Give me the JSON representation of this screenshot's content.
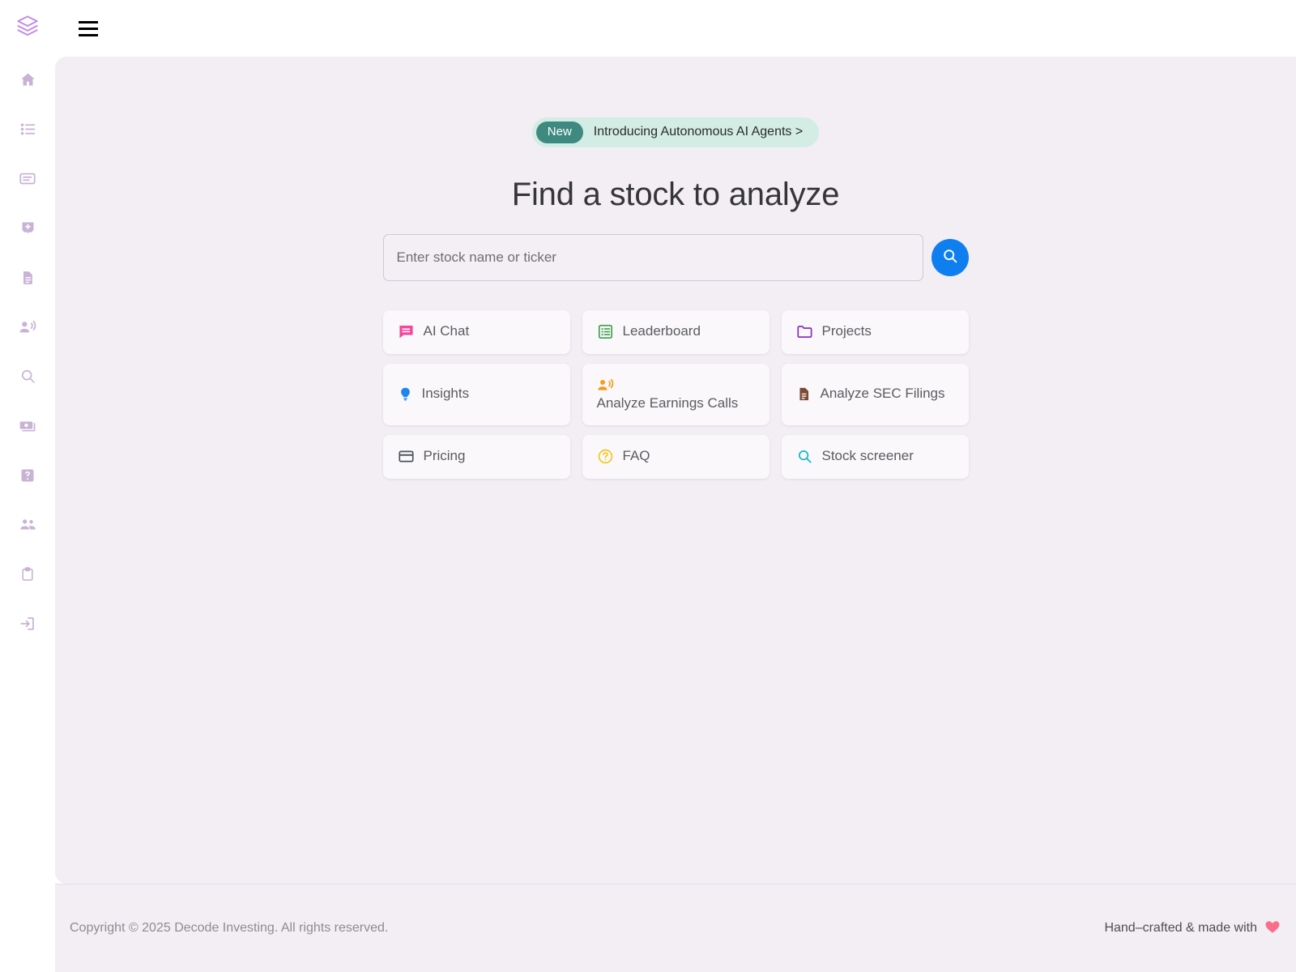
{
  "brand": {
    "logo_icon": "layers-icon",
    "logo_color": "#c48ae8"
  },
  "topbar": {
    "menu_icon": "hamburger-menu-icon"
  },
  "sidebar": {
    "items": [
      {
        "icon": "home-icon",
        "name": "home"
      },
      {
        "icon": "list-ordered-icon",
        "name": "watchlist"
      },
      {
        "icon": "monitor-list-icon",
        "name": "dashboard"
      },
      {
        "icon": "badge-plus-icon",
        "name": "add-stock"
      },
      {
        "icon": "document-icon",
        "name": "filings"
      },
      {
        "icon": "record-voice-icon",
        "name": "earnings-calls"
      },
      {
        "icon": "search-icon",
        "name": "screener"
      },
      {
        "icon": "money-icon",
        "name": "pricing"
      },
      {
        "icon": "question-box-icon",
        "name": "faq"
      },
      {
        "icon": "people-icon",
        "name": "community"
      },
      {
        "icon": "clipboard-icon",
        "name": "projects"
      },
      {
        "icon": "login-icon",
        "name": "sign-in"
      }
    ]
  },
  "announcement": {
    "pill_label": "New",
    "text": "Introducing Autonomous AI Agents >",
    "bg_color": "#d3ede5",
    "pill_color": "#3f8a80"
  },
  "hero": {
    "headline": "Find a stock to analyze"
  },
  "search": {
    "placeholder": "Enter stock name or ticker",
    "value": "",
    "button_icon": "search-icon",
    "button_color": "#0f7ff0"
  },
  "tiles": [
    {
      "label": "AI Chat",
      "icon": "chat-bubble-icon",
      "color": "#f5459c",
      "tall": false
    },
    {
      "label": "Leaderboard",
      "icon": "list-board-icon",
      "color": "#3f9e4d",
      "tall": false
    },
    {
      "label": "Projects",
      "icon": "folder-icon",
      "color": "#8a2fc4",
      "tall": false
    },
    {
      "label": "Insights",
      "icon": "lightbulb-icon",
      "color": "#1f86f0",
      "tall": true
    },
    {
      "label": "Analyze Earnings Calls",
      "icon": "record-voice-icon",
      "color": "#f59b19",
      "tall": true
    },
    {
      "label": "Analyze SEC Filings",
      "icon": "document-icon",
      "color": "#7a4a36",
      "tall": true
    },
    {
      "label": "Pricing",
      "icon": "credit-card-icon",
      "color": "#4a5560",
      "tall": false
    },
    {
      "label": "FAQ",
      "icon": "question-circle-icon",
      "color": "#f5c518",
      "tall": false
    },
    {
      "label": "Stock screener",
      "icon": "search-icon",
      "color": "#16b6c9",
      "tall": false
    }
  ],
  "footer": {
    "copyright": "Copyright © 2025 Decode Investing. All rights reserved.",
    "made_with_text": "Hand–crafted & made with",
    "heart_icon": "heart-icon",
    "heart_color": "#fb6e8a"
  }
}
